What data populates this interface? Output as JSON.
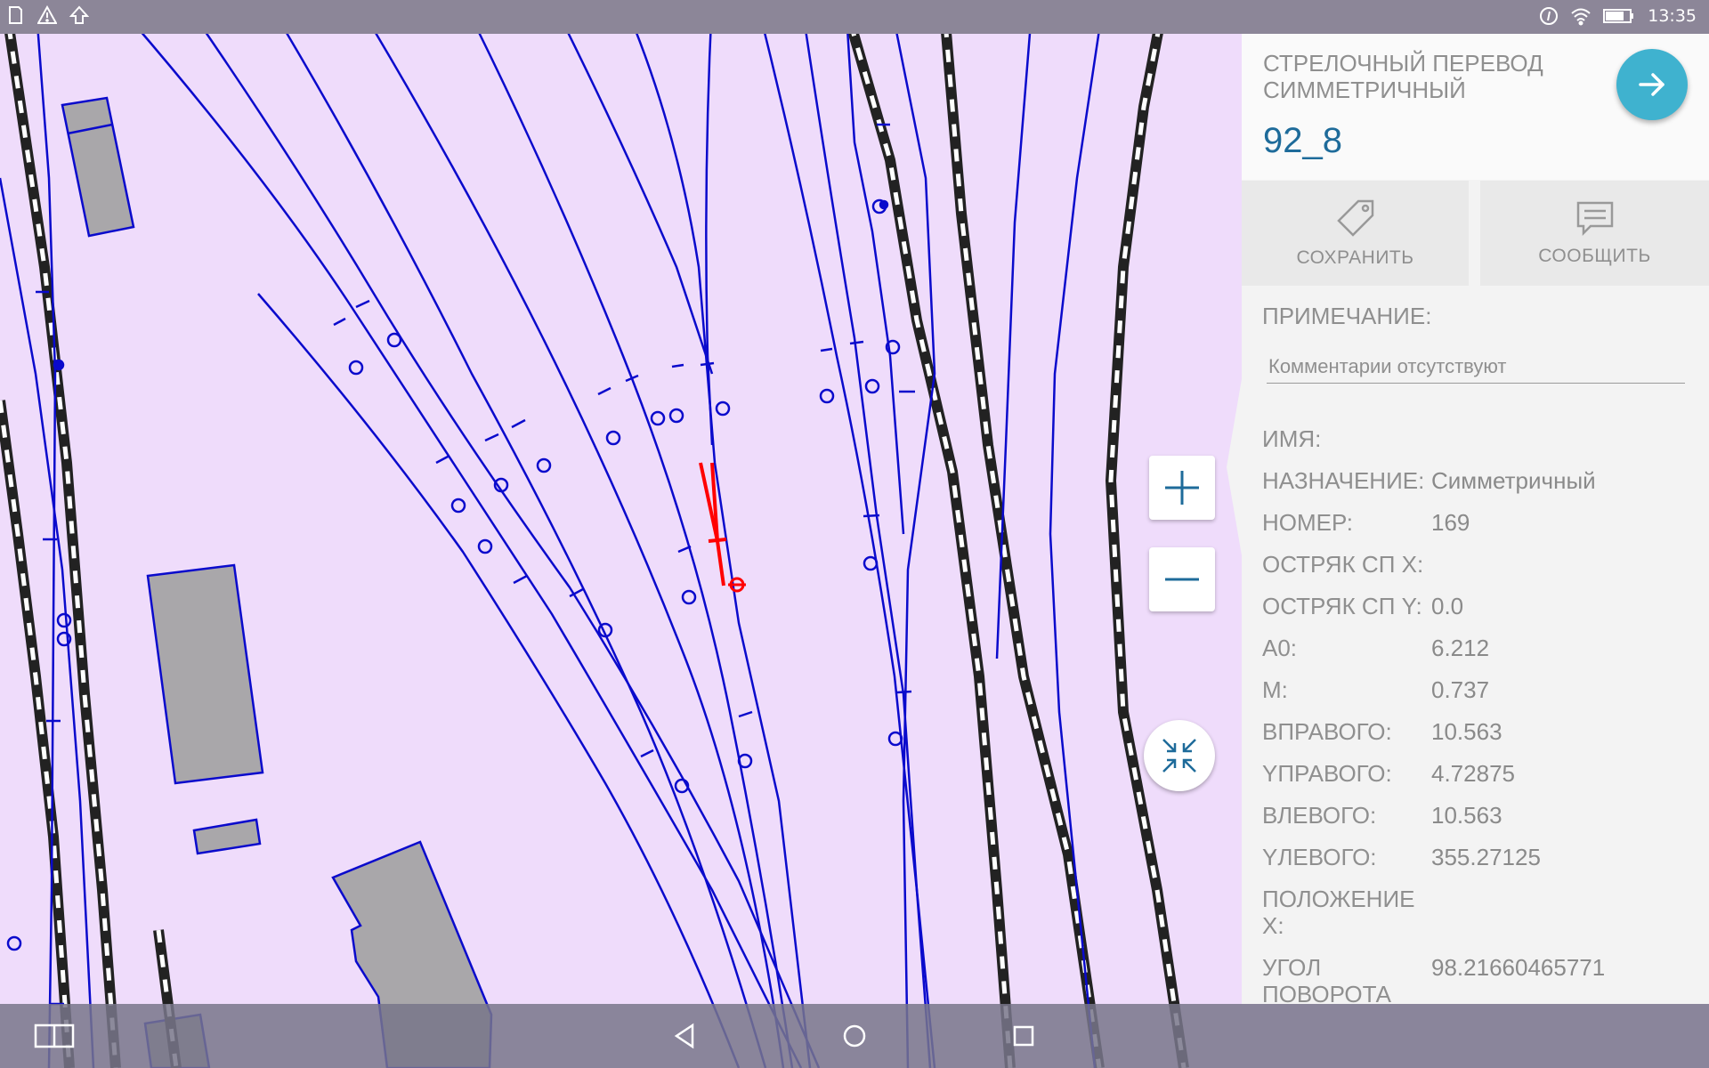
{
  "status_bar": {
    "left_icons": [
      "sd-card-icon",
      "warning-icon",
      "upload-icon"
    ],
    "right_icons": [
      "location-icon",
      "wifi-icon",
      "battery-icon"
    ],
    "time": "13:35"
  },
  "map": {
    "background_color": "#efdcfb",
    "track_color": "#0a0acc",
    "selected_color": "#ff0000",
    "building_color": "#a9a7aa",
    "zoom_in_icon": "plus-icon",
    "zoom_out_icon": "minus-icon",
    "collapse_icon": "collapse-arrows-icon"
  },
  "panel": {
    "type_label": "СТРЕЛОЧНЫЙ ПЕРЕВОД СИММЕТРИЧНЫЙ",
    "object_id": "92_8",
    "go_icon": "arrow-right-icon",
    "actions": [
      {
        "label": "СОХРАНИТЬ",
        "icon": "tag-icon"
      },
      {
        "label": "СООБЩИТЬ",
        "icon": "message-icon"
      }
    ],
    "note_label": "ПРИМЕЧАНИЕ:",
    "note_placeholder": "Комментарии отсутствуют",
    "properties": [
      {
        "key": "ИМЯ:",
        "value": ""
      },
      {
        "key": "НАЗНАЧЕНИЕ:",
        "value": "Симметричный"
      },
      {
        "key": "НОМЕР:",
        "value": "169"
      },
      {
        "key": "ОСТРЯК СП X:",
        "value": ""
      },
      {
        "key": "ОСТРЯК СП Y:",
        "value": "0.0"
      },
      {
        "key": "A0:",
        "value": "6.212"
      },
      {
        "key": "M:",
        "value": "0.737"
      },
      {
        "key": "ВПРАВОГО:",
        "value": "10.563"
      },
      {
        "key": "YПРАВОГО:",
        "value": "4.72875"
      },
      {
        "key": "ВЛЕВОГО:",
        "value": "10.563"
      },
      {
        "key": "YЛЕВОГО:",
        "value": "355.27125"
      },
      {
        "key": "ПОЛОЖЕНИЕ X:",
        "value": ""
      },
      {
        "key": "УГОЛ ПОВОРОТА СП:",
        "value": "98.21660465771"
      }
    ]
  },
  "nav_bar": {
    "icons": [
      "split-screen-icon",
      "back-icon",
      "home-icon",
      "recents-icon"
    ]
  }
}
